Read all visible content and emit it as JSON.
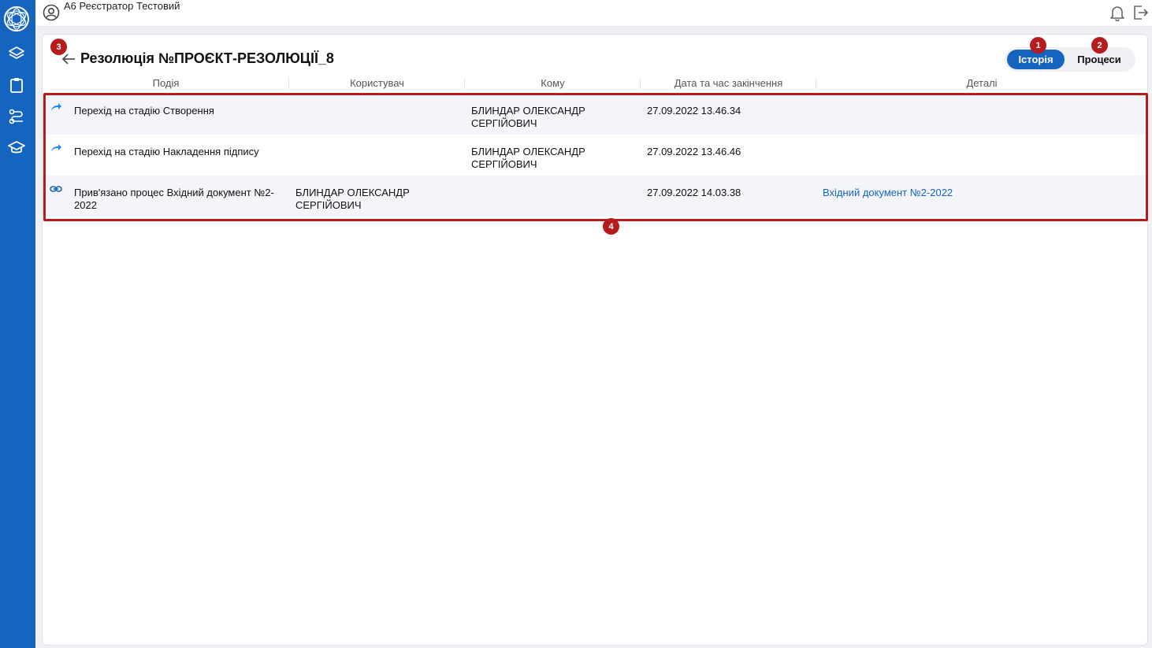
{
  "app": {
    "user_name": "А6 Реєстратор Тестовий"
  },
  "sidebar": {
    "items": [
      {
        "icon": "layers-icon"
      },
      {
        "icon": "clipboard-icon"
      },
      {
        "icon": "process-route-icon"
      },
      {
        "icon": "graduation-cap-icon"
      }
    ]
  },
  "header": {
    "title": "Резолюція №ПРОЄКТ-РЕЗОЛЮЦІЇ_8",
    "tabs": [
      {
        "label": "Історія",
        "active": true
      },
      {
        "label": "Процеси",
        "active": false
      }
    ]
  },
  "table": {
    "columns": [
      "Подія",
      "Користувач",
      "Кому",
      "Дата та час закінчення",
      "Деталі"
    ],
    "rows": [
      {
        "icon": "forward-arrow-icon",
        "event": "Перехід на стадію Створення",
        "user": "",
        "to": "БЛИНДАР ОЛЕКСАНДР СЕРГІЙОВИЧ",
        "date": "27.09.2022 13.46.34",
        "details": ""
      },
      {
        "icon": "forward-arrow-icon",
        "event": "Перехід на стадію Накладення підпису",
        "user": "",
        "to": "БЛИНДАР ОЛЕКСАНДР СЕРГІЙОВИЧ",
        "date": "27.09.2022 13.46.46",
        "details": ""
      },
      {
        "icon": "link-icon",
        "event": "Прив'язано процес Вхідний документ №2-2022",
        "user": "БЛИНДАР ОЛЕКСАНДР СЕРГІЙОВИЧ",
        "to": "",
        "date": "27.09.2022 14.03.38",
        "details": "Вхідний документ №2-2022"
      }
    ]
  },
  "markers": [
    "1",
    "2",
    "3",
    "4"
  ],
  "colors": {
    "brand": "#1565c0",
    "marker": "#b71c1c",
    "row_alt": "#f4f5fa"
  }
}
